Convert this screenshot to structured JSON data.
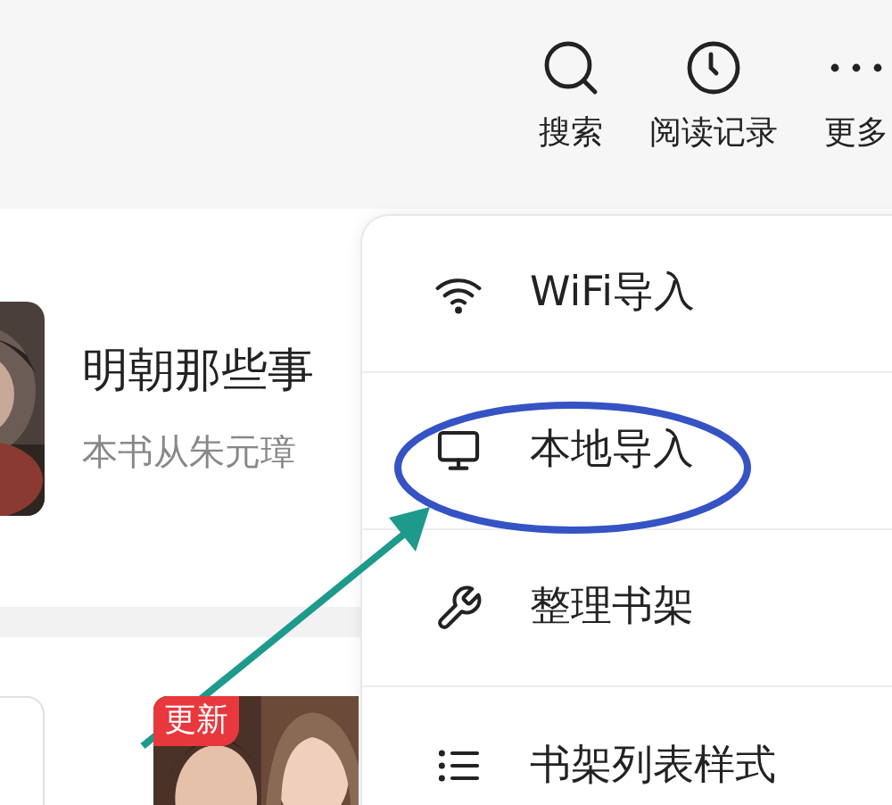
{
  "top_bar": {
    "actions": [
      {
        "kind": "search",
        "label": "搜索"
      },
      {
        "kind": "history",
        "label": "阅读记录"
      },
      {
        "kind": "more",
        "label": "更多"
      }
    ]
  },
  "books": [
    {
      "title": "明朝那些事",
      "description": "本书从朱元璋"
    }
  ],
  "next_book": {
    "badge": "更新"
  },
  "menu": {
    "items": [
      {
        "kind": "wifi",
        "label": "WiFi导入",
        "circled": false
      },
      {
        "kind": "monitor",
        "label": "本地导入",
        "circled": true
      },
      {
        "kind": "wrench",
        "label": "整理书架",
        "circled": false
      },
      {
        "kind": "list",
        "label": "书架列表样式",
        "circled": false
      }
    ]
  },
  "annotation_arrow": true
}
